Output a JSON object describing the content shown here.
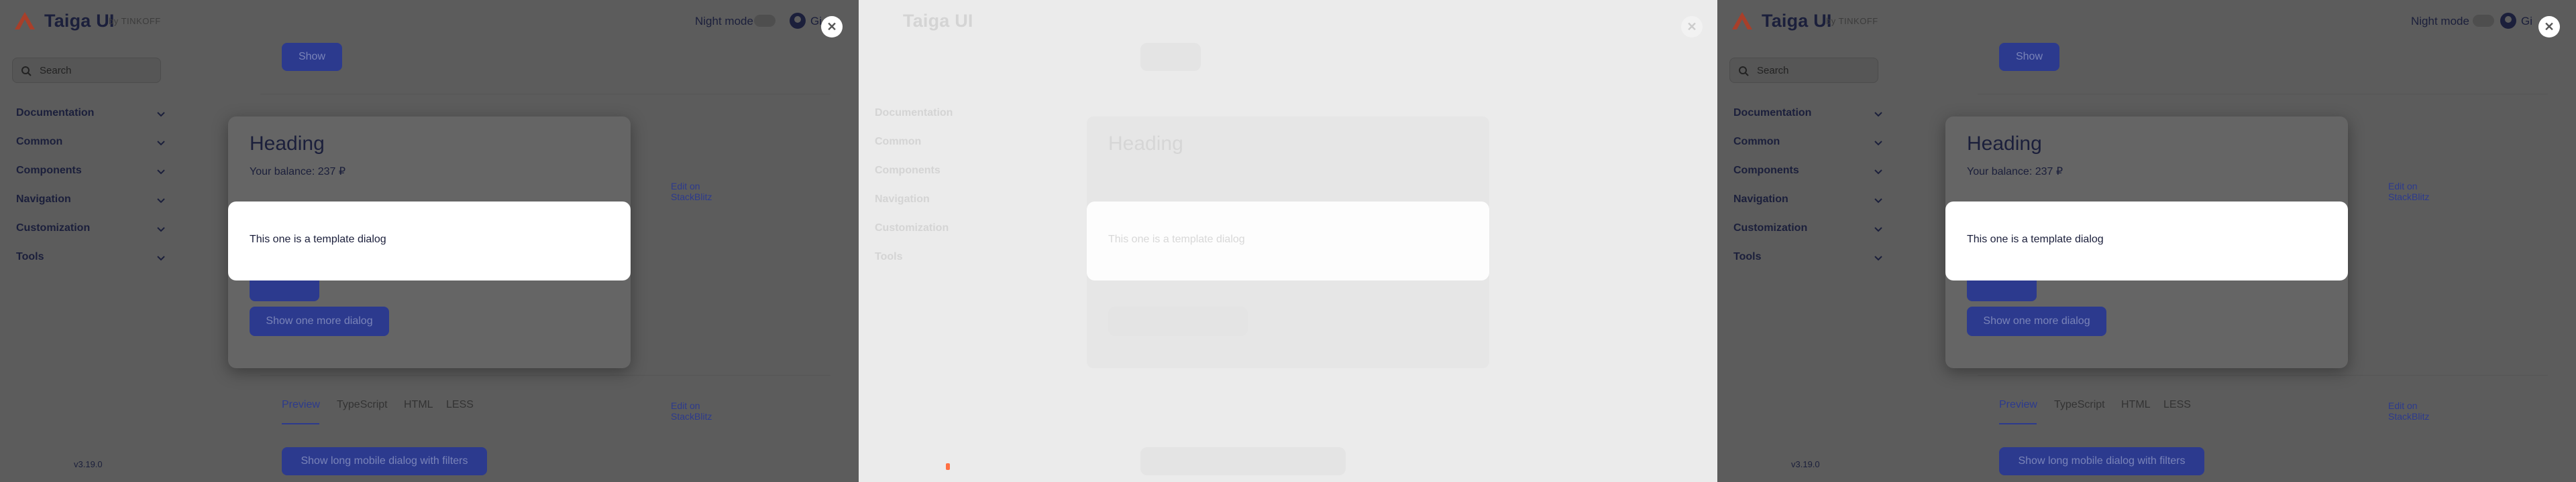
{
  "header": {
    "brand": "Taiga UI",
    "byline": "by TINKOFF",
    "night_mode_label": "Night mode",
    "github_label": "Gi"
  },
  "sidebar": {
    "search_placeholder": "Search",
    "items": [
      {
        "label": "Documentation"
      },
      {
        "label": "Common"
      },
      {
        "label": "Components"
      },
      {
        "label": "Navigation"
      },
      {
        "label": "Customization"
      },
      {
        "label": "Tools"
      }
    ],
    "version": "v3.19.0"
  },
  "content": {
    "show_button": "Show",
    "edit_stackblitz": "Edit on StackBlitz",
    "tabs": [
      "Preview",
      "TypeScript",
      "HTML",
      "LESS"
    ],
    "show_long_button": "Show long mobile dialog with filters"
  },
  "background_dialog": {
    "heading": "Heading",
    "balance": "Your balance: 237 ₽",
    "more_button": "Show one more dialog"
  },
  "template_dialog": {
    "text": "This one is a template dialog",
    "close_symbol": "✕"
  },
  "colors": {
    "overlay_dark": "#5c5c5c",
    "overlay_light": "#ebebeb",
    "primary": "#2c3a8e",
    "logo": "#ff5a3c"
  }
}
